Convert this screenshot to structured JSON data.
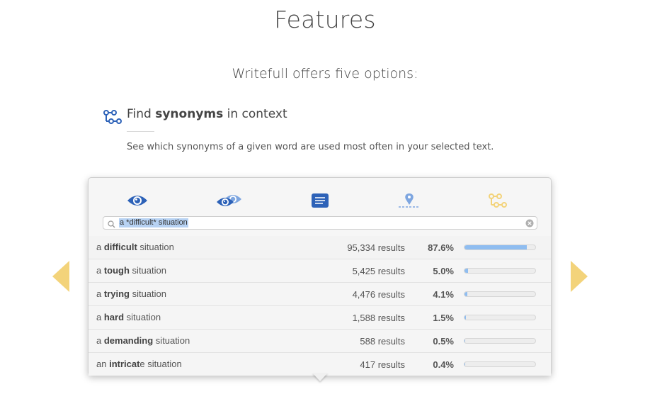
{
  "header": {
    "title": "Features",
    "subtitle": "Writefull offers five options:"
  },
  "feature": {
    "icon": "synonyms-icon",
    "heading_prefix": "Find ",
    "heading_bold": "synonyms",
    "heading_suffix": " in context",
    "description": "See which synonyms of a given word are used most often in your selected text."
  },
  "toolbar": {
    "tools": [
      "eye-icon",
      "compare-icon",
      "text-icon",
      "location-icon",
      "synonyms-icon"
    ]
  },
  "search": {
    "query": "a *difficult* situation"
  },
  "results": [
    {
      "pre": "a ",
      "bold": "difficult",
      "post": " situation",
      "count": "95,334 results",
      "percent": "87.6%",
      "fraction": 0.876
    },
    {
      "pre": "a ",
      "bold": "tough",
      "post": " situation",
      "count": "5,425 results",
      "percent": "5.0%",
      "fraction": 0.05
    },
    {
      "pre": "a ",
      "bold": "trying",
      "post": " situation",
      "count": "4,476 results",
      "percent": "4.1%",
      "fraction": 0.041
    },
    {
      "pre": "a ",
      "bold": "hard",
      "post": " situation",
      "count": "1,588 results",
      "percent": "1.5%",
      "fraction": 0.015
    },
    {
      "pre": "a ",
      "bold": "demanding",
      "post": " situation",
      "count": "588 results",
      "percent": "0.5%",
      "fraction": 0.005
    },
    {
      "pre": "an ",
      "bold": "intricat",
      "post": "e situation",
      "count": "417 results",
      "percent": "0.4%",
      "fraction": 0.004
    }
  ],
  "colors": {
    "primary_blue": "#2d62b8",
    "light_blue": "#7ea6e0",
    "bar_fill": "#8fbdf0",
    "accent_yellow": "#f3d37a"
  }
}
